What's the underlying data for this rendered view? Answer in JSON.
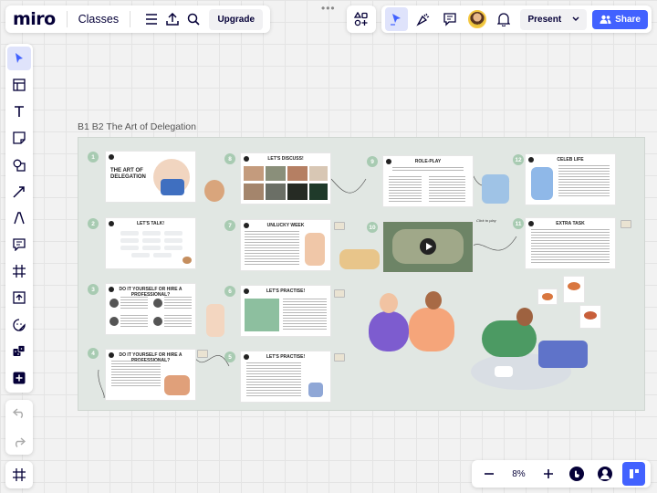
{
  "topbar": {
    "logo": "miro",
    "board_title": "Classes",
    "upgrade_label": "Upgrade",
    "menu_icon": "hamburger-icon",
    "export_icon": "upload-icon",
    "search_icon": "search-icon"
  },
  "topbar_right": {
    "apps_icon": "apps-add-icon",
    "present_label": "Present",
    "share_label": "Share"
  },
  "left_toolbar": [
    "select-cursor-icon",
    "templates-icon",
    "text-icon",
    "sticky-note-icon",
    "shapes-icon",
    "arrow-line-icon",
    "pen-icon",
    "comment-icon",
    "frame-icon",
    "upload-icon",
    "sticker-icon",
    "dice-icon",
    "add-more-icon"
  ],
  "zoom": {
    "level": "8%"
  },
  "frame": {
    "label": "B1 B2 The Art of Delegation",
    "slides": {
      "s1_title": "THE ART OF DELEGATION",
      "s8_title": "LET'S DISCUSS!",
      "s9_title": "ROLE-PLAY",
      "s12_title": "CELEB LIFE",
      "s2_title": "LET'S TALK!",
      "s7_title": "UNLUCKY WEEK",
      "s11_title": "EXTRA TASK",
      "s3_title": "DO IT YOURSELF OR HIRE A PROFESSIONAL?",
      "s6_title": "LET'S PRACTISE!",
      "s4_title": "DO IT YOURSELF OR HIRE A PROFESSIONAL?",
      "s5_title": "LET'S PRACTISE!"
    },
    "numbers": [
      "1",
      "8",
      "9",
      "12",
      "2",
      "7",
      "10",
      "11",
      "3",
      "6",
      "4",
      "5"
    ],
    "note_click": "Click to play"
  },
  "colors": {
    "accent": "#4262ff",
    "frame_bg": "#e1e7e3",
    "badge": "#a8cbb2"
  }
}
